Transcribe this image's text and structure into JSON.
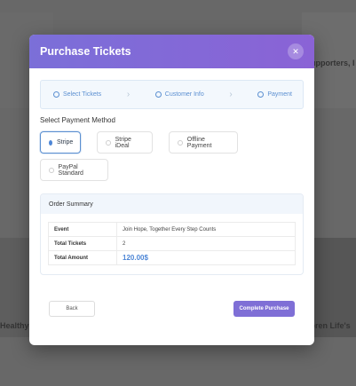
{
  "background": {
    "text_right_top": "Supporters, I",
    "text_right_bottom": "Loren Life's",
    "text_left_bottom": "Healthy"
  },
  "modal": {
    "title": "Purchase Tickets",
    "close_icon": "close-icon",
    "steps": [
      {
        "label": "Select Tickets"
      },
      {
        "label": "Customer Info"
      },
      {
        "label": "Payment"
      }
    ],
    "section_title": "Select Payment Method",
    "payment_methods": [
      {
        "label": "Stripe",
        "selected": true
      },
      {
        "label": "Stripe iDeal",
        "selected": false
      },
      {
        "label": "Offline Payment",
        "selected": false
      },
      {
        "label": "PayPal Standard",
        "selected": false
      }
    ],
    "order_summary": {
      "title": "Order Summary",
      "rows": [
        {
          "key": "Event",
          "value": "Join Hope, Together Every Step Counts"
        },
        {
          "key": "Total Tickets",
          "value": "2"
        },
        {
          "key": "Total Amount",
          "value": "120.00$"
        }
      ]
    },
    "buttons": {
      "back": "Back",
      "complete": "Complete Purchase"
    }
  },
  "colors": {
    "header_gradient_start": "#7b6fd8",
    "header_gradient_end": "#8a63d6",
    "accent": "#4d86d6",
    "primary_button": "#7f6fd6"
  }
}
